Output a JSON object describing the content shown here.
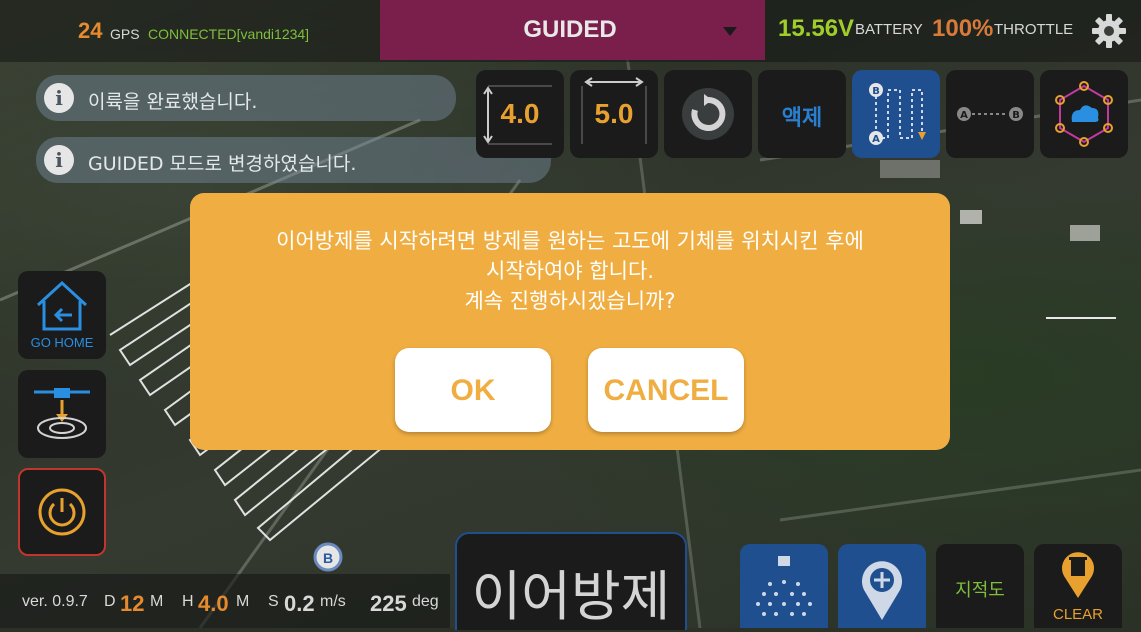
{
  "status_bar": {
    "gps_count": "24",
    "gps_label": "GPS",
    "gps_status": "CONNECTED[vandi1234]",
    "flight_mode": "GUIDED",
    "voltage": "15.56V",
    "battery_label": "BATTERY",
    "throttle_value": "100%",
    "throttle_label": "THROTTLE"
  },
  "notices": [
    {
      "text": "이륙을 완료했습니다."
    },
    {
      "text": "GUIDED 모드로 변경하였습니다."
    }
  ],
  "toolbar": {
    "altitude_value": "4.0",
    "width_value": "5.0",
    "liquid_label": "액제"
  },
  "side_buttons": {
    "go_home_label": "GO HOME"
  },
  "map": {
    "marker_b": "B"
  },
  "dialog": {
    "message_lines": [
      "이어방제를 시작하려면 방제를 원하는 고도에 기체를 위치시킨 후에",
      "시작하여야 합니다.",
      "계속 진행하시겠습니까?"
    ],
    "ok_label": "OK",
    "cancel_label": "CANCEL"
  },
  "bottom": {
    "version": "ver. 0.9.7",
    "d_label": "D",
    "d_value": "12",
    "d_unit": "M",
    "h_label": "H",
    "h_value": "4.0",
    "h_unit": "M",
    "s_label": "S",
    "s_value": "0.2",
    "s_unit": "m/s",
    "heading_value": "225",
    "heading_unit": "deg",
    "continue_spray_label": "이어방제",
    "map_label": "지적도",
    "clear_label": "CLEAR"
  },
  "colors": {
    "dialog_bg": "#f0ae42",
    "mode_bg": "#7a1f4b",
    "accent_blue": "#1f4f8f",
    "orange": "#e58a2e",
    "green": "#9fce2a"
  }
}
